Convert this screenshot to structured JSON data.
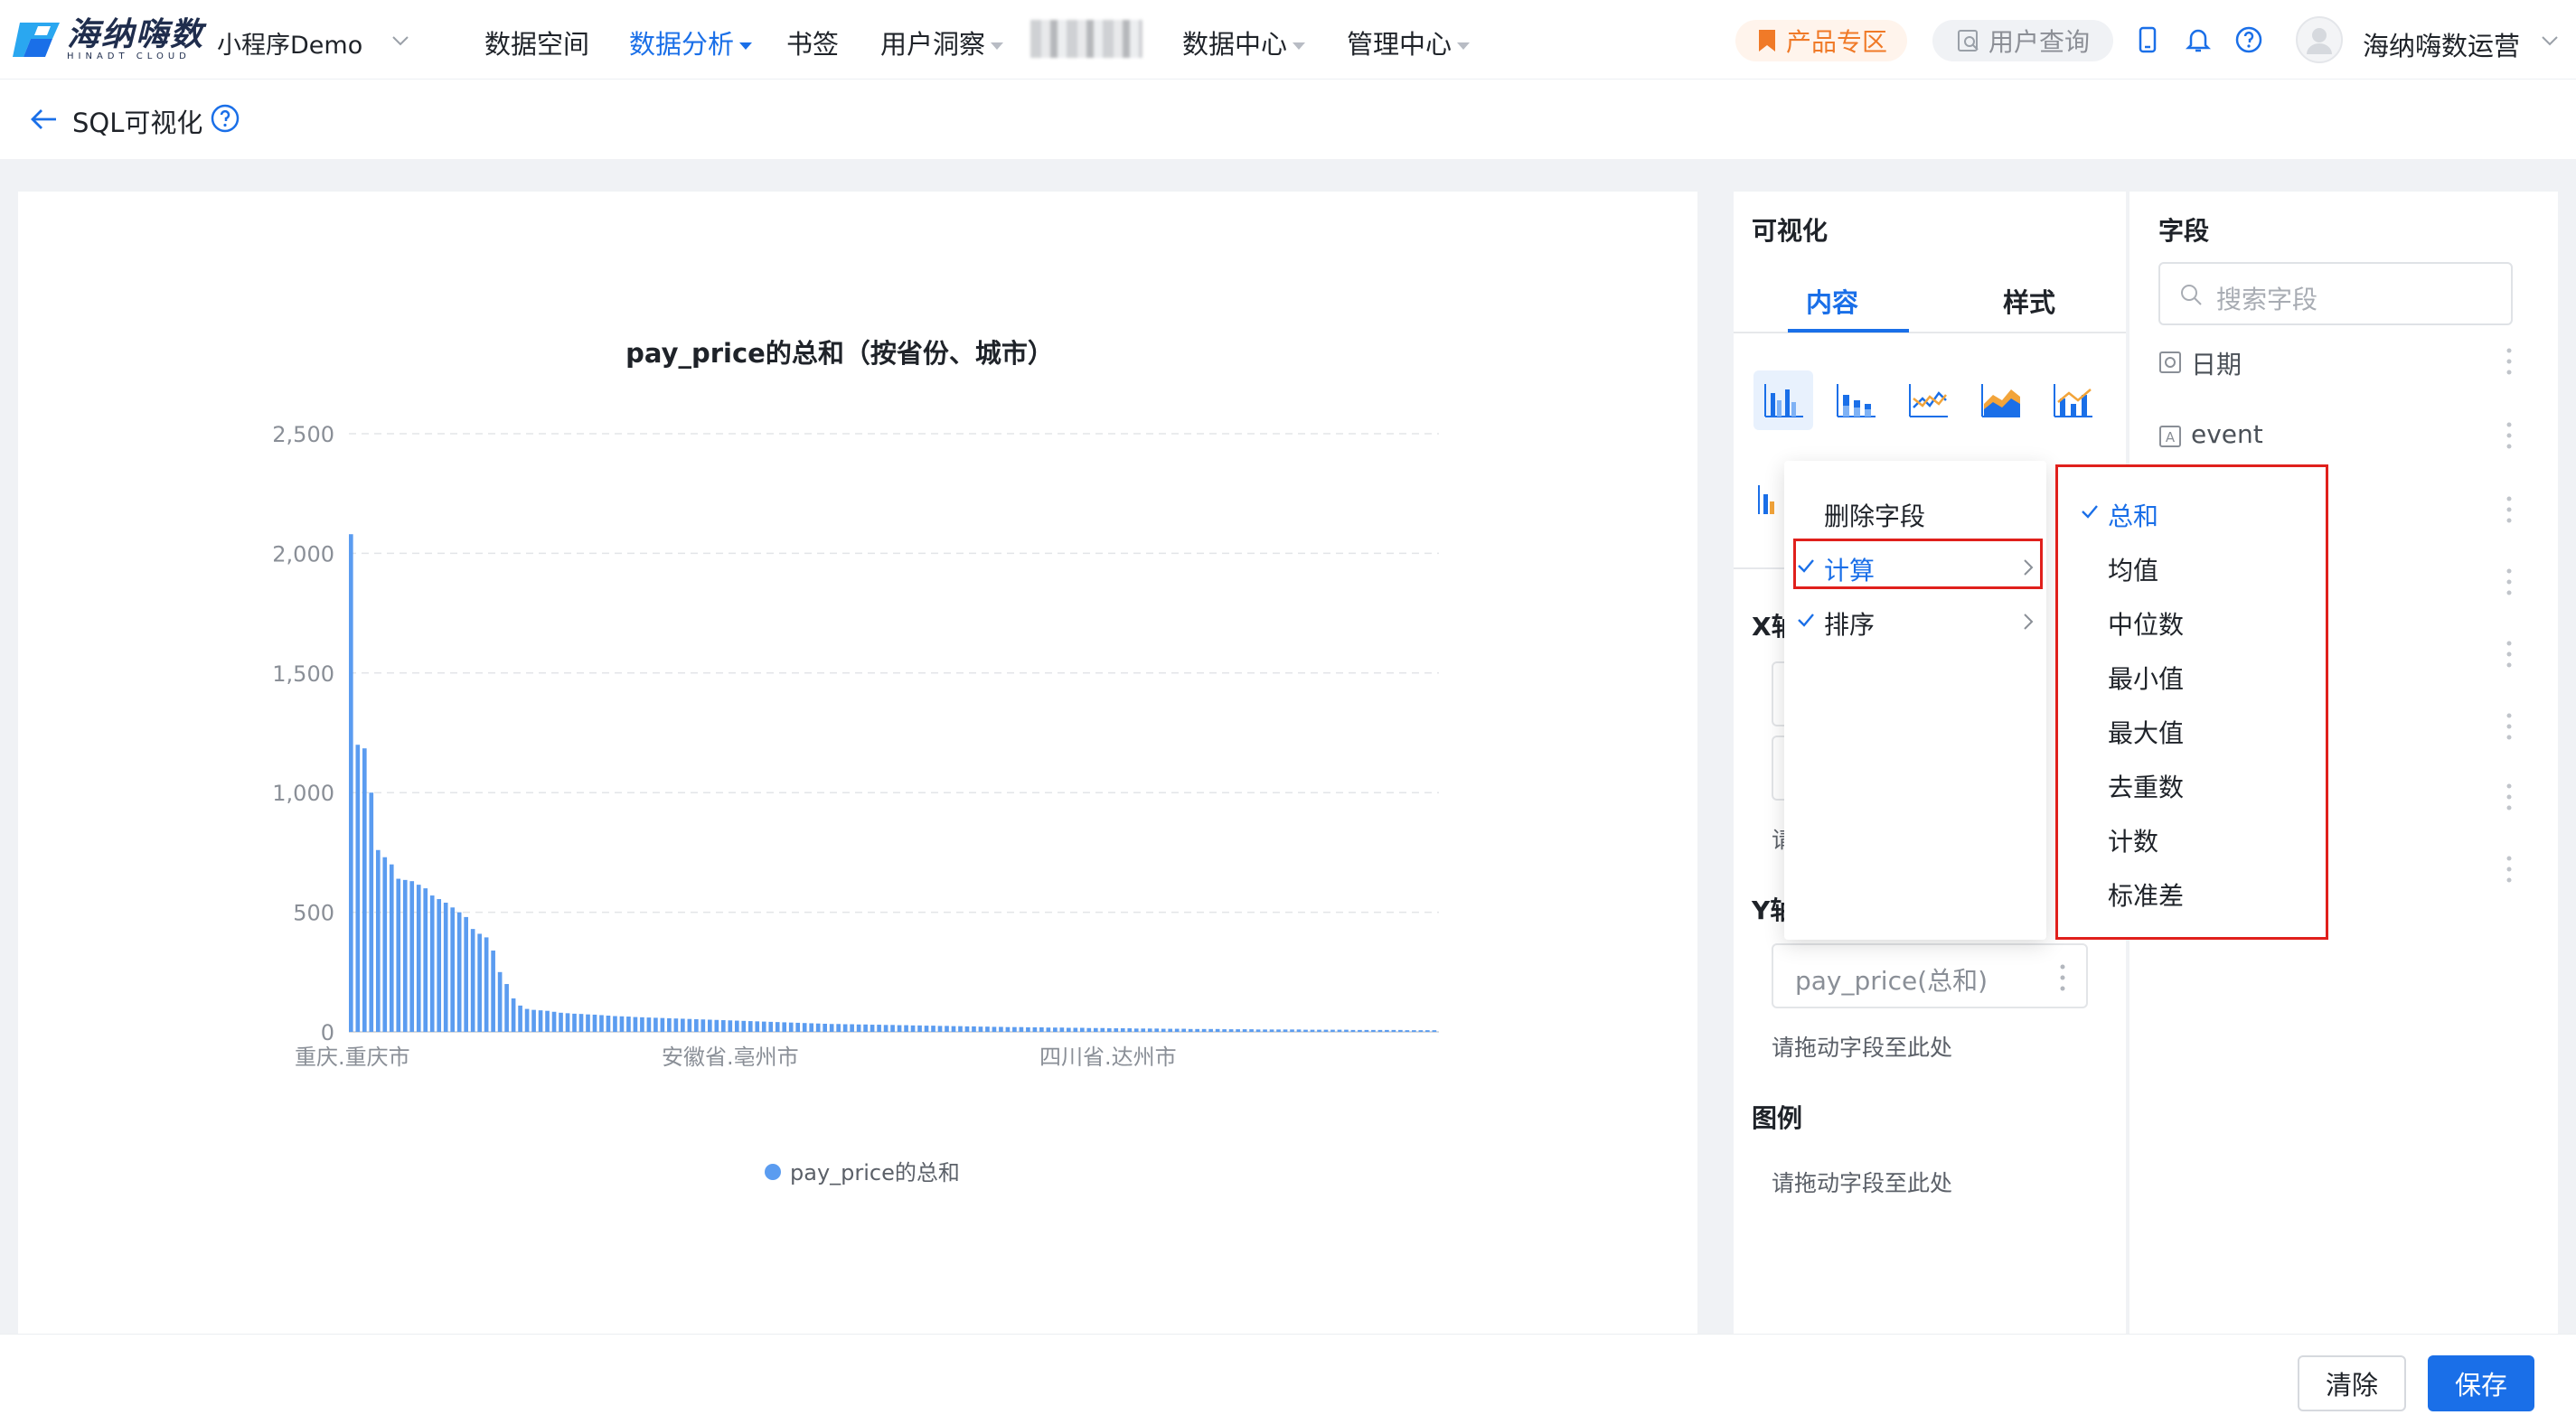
{
  "brand": {
    "name_cn": "海纳嗨数",
    "name_en": "HINADT CLOUD"
  },
  "project": "小程序Demo",
  "nav": [
    {
      "label": "数据空间"
    },
    {
      "label": "数据分析"
    },
    {
      "label": "书签"
    },
    {
      "label": "用户洞察"
    },
    {
      "label": "数据中心"
    },
    {
      "label": "管理中心"
    }
  ],
  "toolbar": {
    "product_zone": "产品专区",
    "user_query": "用户查询",
    "username": "海纳嗨数运营"
  },
  "page": {
    "title": "SQL可视化"
  },
  "visualization": {
    "heading": "可视化",
    "tabs": [
      "内容",
      "样式"
    ],
    "x_axis_label": "X轴",
    "y_axis_label": "Y轴",
    "y_field": "pay_price(总和)",
    "drop_hint": "请拖动字段至此处",
    "legend_label": "图例",
    "legend_hint": "请拖动字段至此处",
    "truncated_hint": "请"
  },
  "fields": {
    "heading": "字段",
    "search_placeholder": "搜索字段",
    "items": [
      {
        "name": "日期"
      },
      {
        "name": "event"
      }
    ]
  },
  "context_menu": {
    "items": [
      "删除字段",
      "计算",
      "排序"
    ],
    "submenu": [
      "总和",
      "均值",
      "中位数",
      "最小值",
      "最大值",
      "去重数",
      "计数",
      "标准差"
    ],
    "selected_aggregation": "总和"
  },
  "footer": {
    "clear": "清除",
    "save": "保存"
  },
  "colors": {
    "accent": "#1a6fe8",
    "bar": "#5b9cf0",
    "highlight_box": "#e0201c"
  },
  "chart_data": {
    "type": "bar",
    "title": "pay_price的总和（按省份、城市）",
    "xlabel": "",
    "ylabel": "",
    "ylim": [
      0,
      2500
    ],
    "yticks": [
      "0",
      "500",
      "1,000",
      "1,500",
      "2,000",
      "2,500"
    ],
    "category_labels": [
      "重庆.重庆市",
      "安徽省.亳州市",
      "四川省.达州市"
    ],
    "series": [
      {
        "name": "pay_price的总和",
        "values": [
          2080,
          1200,
          1185,
          1000,
          760,
          730,
          700,
          640,
          635,
          630,
          615,
          600,
          570,
          555,
          540,
          520,
          500,
          480,
          430,
          410,
          395,
          340,
          250,
          200,
          140,
          110,
          96,
          92,
          90,
          88,
          84,
          80,
          78,
          76,
          75,
          73,
          72,
          70,
          68,
          66,
          65,
          64,
          62,
          61,
          60,
          59,
          58,
          57,
          56,
          55,
          54,
          53,
          52,
          51,
          50,
          49,
          48,
          47,
          46,
          45,
          44,
          43,
          42,
          41,
          40,
          39,
          38,
          37,
          36,
          35,
          34,
          33,
          33,
          32,
          32,
          31,
          31,
          30,
          30,
          29,
          29,
          28,
          28,
          27,
          27,
          26,
          26,
          25,
          25,
          24,
          24,
          23,
          23,
          22,
          22,
          21,
          21,
          20,
          20,
          20,
          19,
          19,
          19,
          18,
          18,
          18,
          17,
          17,
          17,
          16,
          16,
          16,
          15,
          15,
          15,
          15,
          14,
          14,
          14,
          14,
          13,
          13,
          13,
          13,
          12,
          12,
          12,
          12,
          12,
          11,
          11,
          11,
          11,
          11,
          10,
          10,
          10,
          10,
          10,
          10,
          10,
          9,
          9,
          9,
          9,
          9,
          9,
          9,
          8,
          8,
          8,
          8,
          8,
          8,
          8,
          8,
          7,
          7,
          7,
          7,
          7
        ]
      }
    ],
    "legend": "bottom-center",
    "grid": true
  }
}
